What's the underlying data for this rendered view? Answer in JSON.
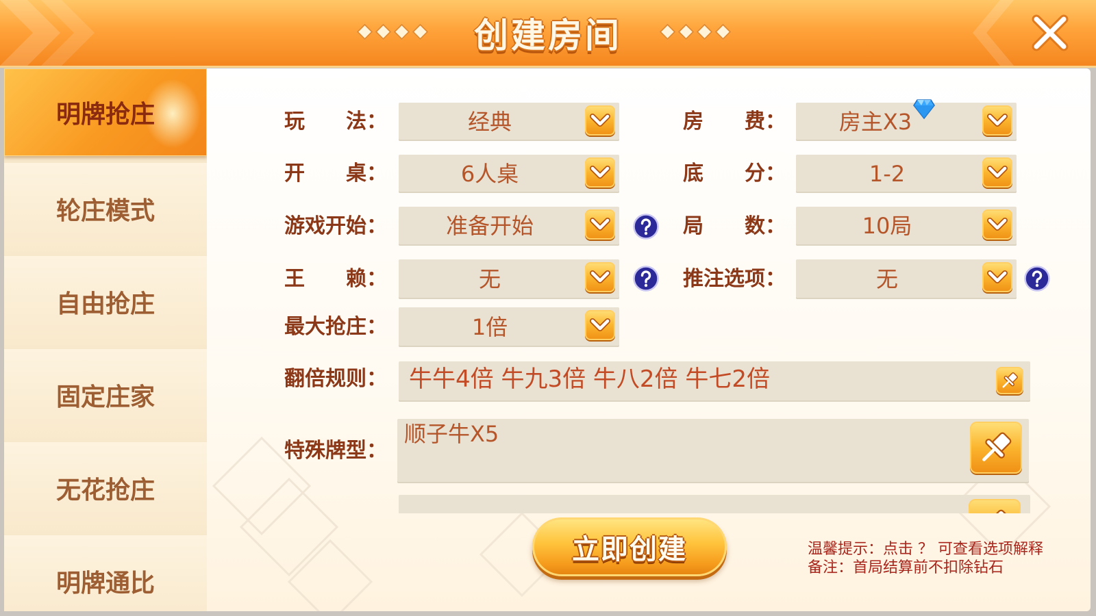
{
  "header": {
    "title": "创建房间"
  },
  "sidebar": {
    "items": [
      {
        "label": "明牌抢庄",
        "selected": true
      },
      {
        "label": "轮庄模式",
        "selected": false
      },
      {
        "label": "自由抢庄",
        "selected": false
      },
      {
        "label": "固定庄家",
        "selected": false
      },
      {
        "label": "无花抢庄",
        "selected": false
      },
      {
        "label": "明牌通比",
        "selected": false
      }
    ]
  },
  "form": {
    "play_mode": {
      "label": "玩　　法：",
      "value": "经典"
    },
    "room_fee": {
      "label": "房　　费：",
      "value": "房主X3"
    },
    "table_size": {
      "label": "开　　桌：",
      "value": "6人桌"
    },
    "base_score": {
      "label": "底　　分：",
      "value": "1-2"
    },
    "game_start": {
      "label": "游戏开始：",
      "value": "准备开始"
    },
    "rounds": {
      "label": "局　　数：",
      "value": "10局"
    },
    "wild_card": {
      "label": "王　　赖：",
      "value": "无"
    },
    "push_bet": {
      "label": "推注选项：",
      "value": "无"
    },
    "max_grab": {
      "label": "最大抢庄：",
      "value": "1倍"
    },
    "double_rules": {
      "label": "翻倍规则：",
      "value": "牛牛4倍 牛九3倍 牛八2倍 牛七2倍"
    },
    "special_hands": {
      "label": "特殊牌型：",
      "value": "顺子牛X5"
    }
  },
  "create_button": {
    "label": "立即创建"
  },
  "hints": {
    "line1": "温馨提示：点击 ？ 可查看选项解释",
    "line2": "备注：首局结算前不扣除钻石"
  },
  "icons": {
    "dropdown": "chevron-down-icon",
    "help": "question-mark-icon",
    "edit": "pushpin-icon",
    "currency": "diamond-gem-icon",
    "close": "close-x-icon"
  },
  "colors": {
    "header_orange": "#f5861f",
    "selected_tab": "#f99a22",
    "label_brown": "#8b3818",
    "value_orange": "#b4552a",
    "input_bg": "#e9e1d2",
    "help_blue": "#2b2a98",
    "gem_blue": "#3aa8ff",
    "hint_red": "#a8261c"
  }
}
